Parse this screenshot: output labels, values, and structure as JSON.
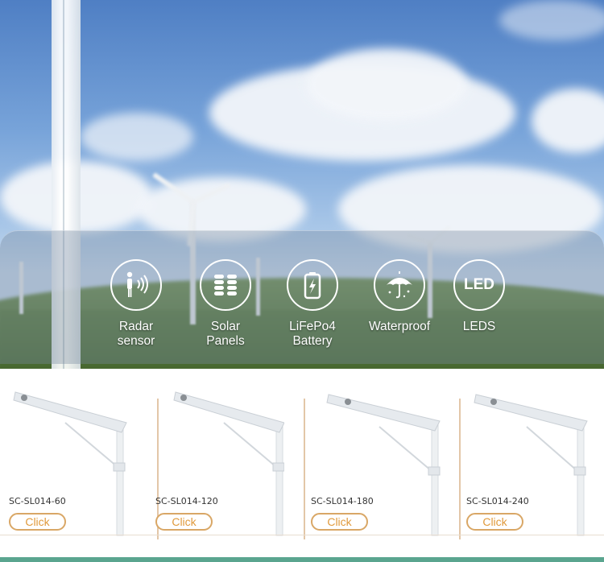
{
  "features": [
    {
      "icon": "radar-sensor-icon",
      "label": "Radar\nsensor"
    },
    {
      "icon": "solar-panel-icon",
      "label": "Solar\nPanels"
    },
    {
      "icon": "battery-icon",
      "label": "LiFePo4\nBattery"
    },
    {
      "icon": "umbrella-icon",
      "label": "Waterproof"
    },
    {
      "icon": "led-icon",
      "icon_text": "LED",
      "label": "LEDS"
    }
  ],
  "products": [
    {
      "model": "SC-SL014-60",
      "button": "Click"
    },
    {
      "model": "SC-SL014-120",
      "button": "Click"
    },
    {
      "model": "SC-SL014-180",
      "button": "Click"
    },
    {
      "model": "SC-SL014-240",
      "button": "Click"
    }
  ],
  "colors": {
    "button_border": "#d9a766",
    "button_text": "#e09a3c",
    "accent_bar": "#5aa58f"
  }
}
